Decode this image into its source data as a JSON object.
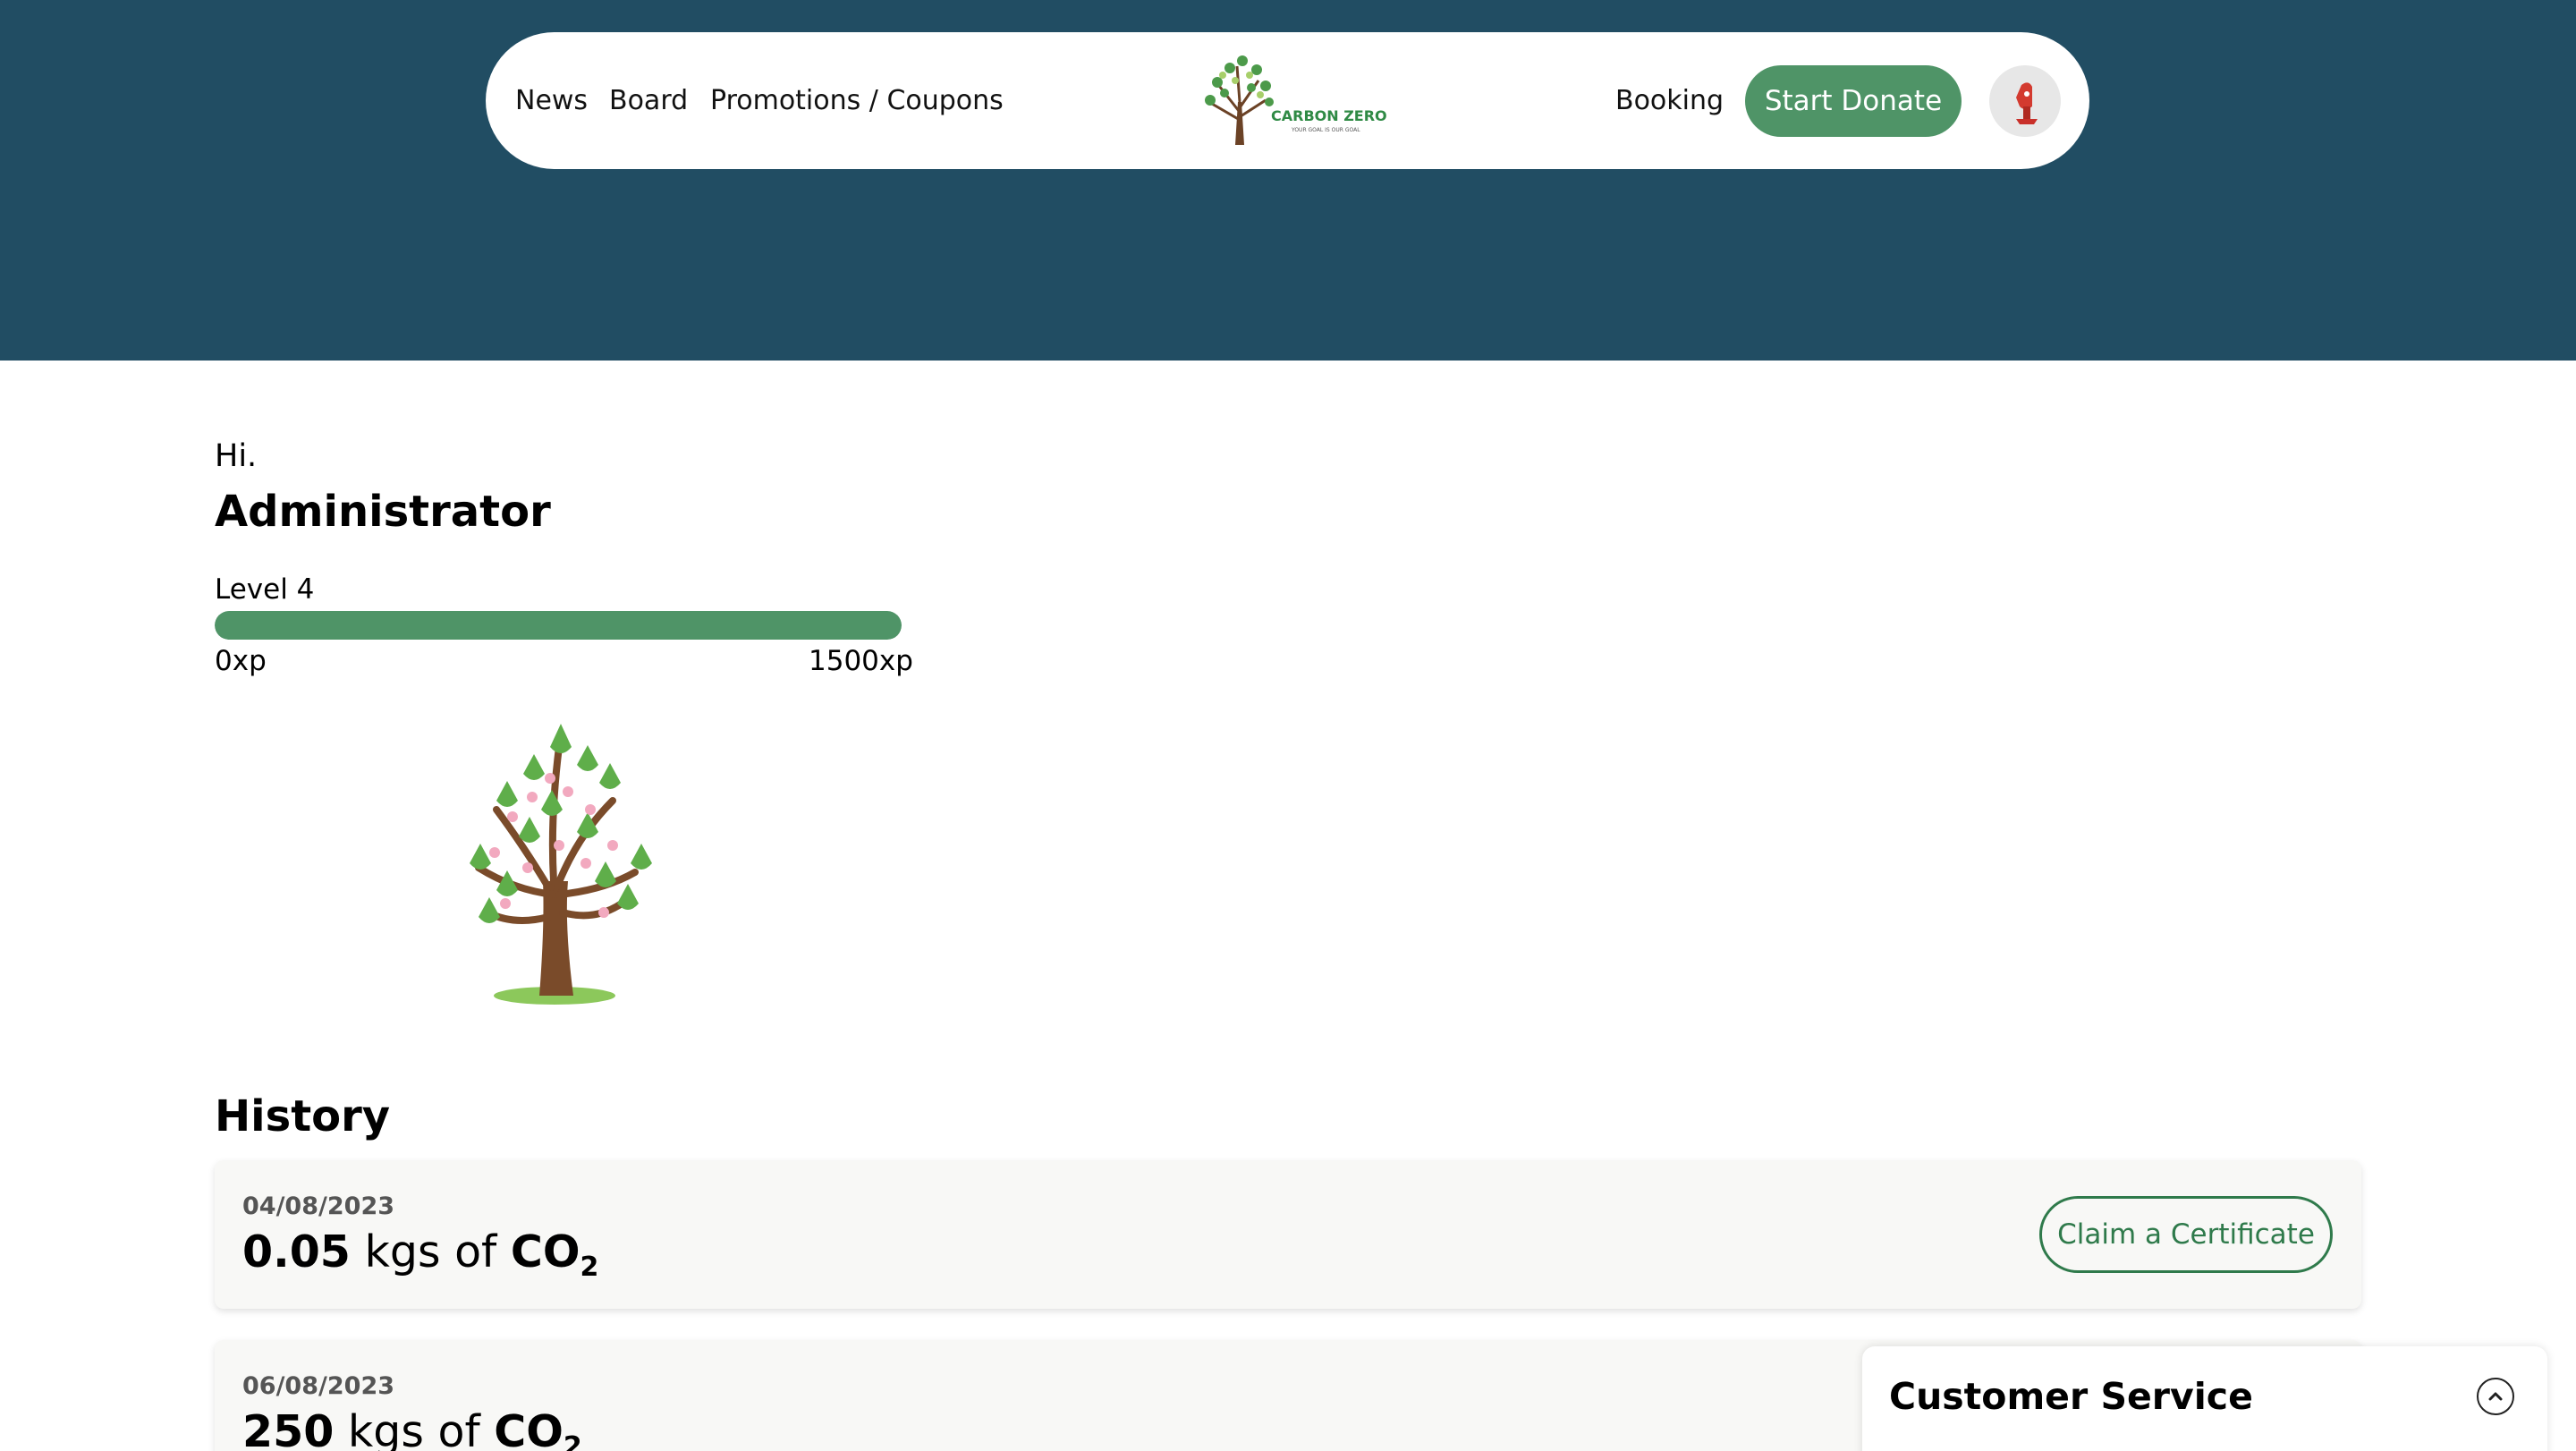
{
  "nav": {
    "links": [
      "News",
      "Board",
      "Promotions / Coupons"
    ],
    "logo_text": "CARBON ZERO",
    "logo_tagline": "YOUR GOAL IS OUR GOAL",
    "booking": "Booking",
    "donate_label": "Start Donate",
    "avatar_icon": "user-avatar-icon"
  },
  "profile": {
    "greeting": "Hi.",
    "name": "Administrator",
    "level_label": "Level 4",
    "xp_min": "0xp",
    "xp_max": "1500xp",
    "xp_progress": 1.0
  },
  "history": {
    "title": "History",
    "claim_label": "Claim a Certificate",
    "unit_text": "kgs of",
    "co2_text": "CO",
    "co2_sub": "2",
    "entries": [
      {
        "date": "04/08/2023",
        "amount": "0.05"
      },
      {
        "date": "06/08/2023",
        "amount": "250"
      }
    ]
  },
  "customer_service": {
    "title": "Customer Service",
    "toggle_icon": "chevron-up-icon"
  },
  "colors": {
    "header_bg": "#214d63",
    "accent_green": "#4f9467",
    "card_bg": "#f8f8f6"
  }
}
